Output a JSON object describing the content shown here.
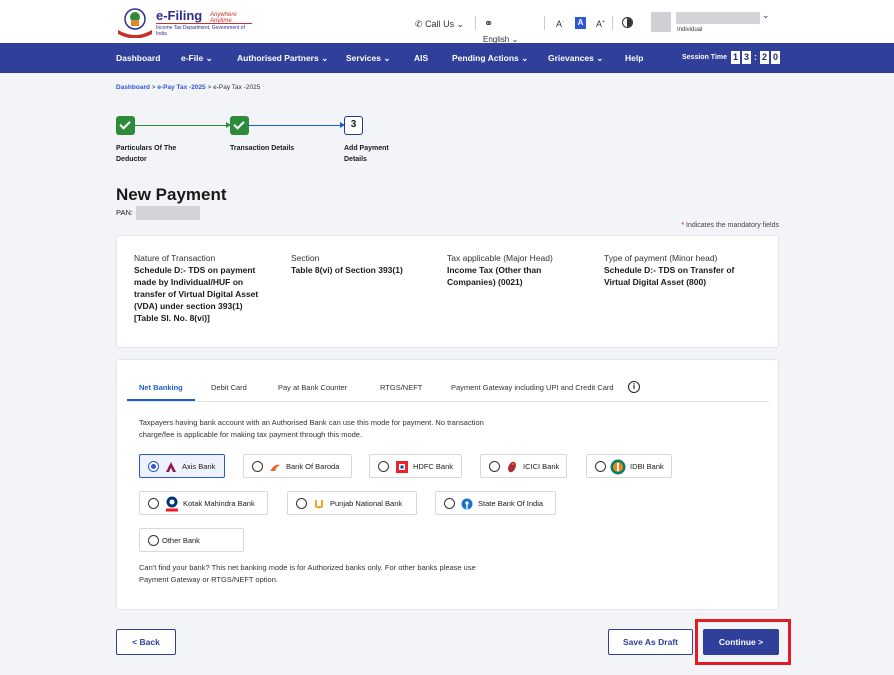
{
  "header": {
    "logo_title": "e-Filing",
    "logo_tagline": "Anywhere Anytime",
    "logo_subtitle": "Income Tax Department, Government of India",
    "call_us": "Call Us",
    "language": "English",
    "font_small": "A",
    "font_normal": "A",
    "font_large": "A",
    "user_type": "Individual"
  },
  "nav": {
    "items": [
      "Dashboard",
      "e-File",
      "Authorised Partners",
      "Services",
      "AIS",
      "Pending Actions",
      "Grievances",
      "Help"
    ],
    "session_label": "Session Time",
    "session_digits": [
      "1",
      "3",
      "2",
      "0"
    ]
  },
  "breadcrumb": {
    "items": [
      "Dashboard",
      "e-Pay Tax -2025",
      "e-Pay Tax -2025"
    ],
    "separator": ">"
  },
  "stepper": {
    "steps": [
      {
        "label_line1": "Particulars Of The",
        "label_line2": "Deductor",
        "status": "done"
      },
      {
        "label_line1": "Transaction Details",
        "label_line2": "",
        "status": "done"
      },
      {
        "number": "3",
        "label_line1": "Add Payment",
        "label_line2": "Details",
        "status": "current"
      }
    ]
  },
  "page": {
    "title": "New Payment",
    "pan_label": "PAN:",
    "mandatory_star": "*",
    "mandatory_note": "Indicates the mandatory fields"
  },
  "summary": {
    "nature_head": "Nature of Transaction",
    "nature_lines": [
      "Schedule D:- TDS on payment",
      "made by Individual/HUF on",
      "transfer of Virtual Digital Asset",
      "(VDA) under section 393(1)",
      "[Table Sl. No. 8(vi)]"
    ],
    "section_head": "Section",
    "section_value": "Table 8(vi) of Section 393(1)",
    "tax_head": "Tax applicable (Major Head)",
    "tax_lines": [
      "Income Tax (Other than",
      "Companies) (0021)"
    ],
    "type_head": "Type of payment (Minor head)",
    "type_lines": [
      "Schedule D:- TDS on Transfer of",
      "Virtual Digital Asset (800)"
    ]
  },
  "payment": {
    "tabs": [
      "Net Banking",
      "Debit Card",
      "Pay at Bank Counter",
      "RTGS/NEFT",
      "Payment Gateway including UPI and Credit Card"
    ],
    "active_tab": "Net Banking",
    "info_icon": "i",
    "desc_line1": "Taxpayers having bank account with an Authorised Bank can use this mode for payment. No transaction",
    "desc_line2": "charge/fee is applicable for making tax payment through this mode.",
    "banks": [
      "Axis Bank",
      "Bank Of Baroda",
      "HDFC Bank",
      "ICICI Bank",
      "IDBI Bank",
      "Kotak Mahindra Bank",
      "Punjab National Bank",
      "State Bank Of India",
      "Other Bank"
    ],
    "selected_bank": "Axis Bank",
    "footer_line1": "Can't find your bank? This net banking mode is for Authorized banks only. For other banks please use",
    "footer_line2": "Payment Gateway or RTGS/NEFT option."
  },
  "actions": {
    "back": "< Back",
    "save_draft": "Save As Draft",
    "continue": "Continue >"
  },
  "colors": {
    "primary": "#2f3f9a",
    "link": "#2d57d7",
    "success": "#2e8b3a",
    "highlight": "#e31b23"
  }
}
